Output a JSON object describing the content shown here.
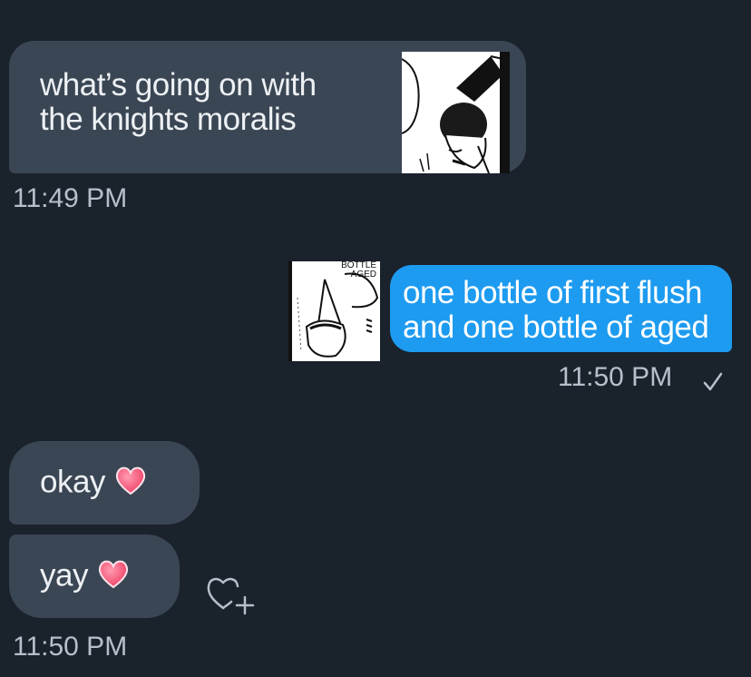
{
  "messages": [
    {
      "id": "m1",
      "direction": "incoming",
      "lines": [
        "what’s going on with",
        "the knights moralis"
      ],
      "has_sticker": true
    },
    {
      "id": "t1",
      "timestamp": "11:49 PM"
    },
    {
      "id": "m2",
      "direction": "outgoing",
      "lines": [
        "one bottle of first flush",
        "and one bottle of aged"
      ],
      "has_sticker": true,
      "sticker_text": [
        "BOTTLE",
        "AGED"
      ]
    },
    {
      "id": "t2",
      "timestamp": "11:50 PM",
      "status": "sent-check-icon"
    },
    {
      "id": "m3",
      "direction": "incoming",
      "text": "okay",
      "emoji": "heart-icon"
    },
    {
      "id": "m4",
      "direction": "incoming",
      "text": "yay",
      "emoji": "heart-icon"
    },
    {
      "id": "t3",
      "timestamp": "11:50 PM"
    }
  ],
  "icons": {
    "reaction": "add-reaction-icon",
    "sent": "check-icon",
    "emoji": "heart-icon"
  },
  "colors": {
    "background": "#1a222c",
    "incoming_bubble": "#3a4654",
    "outgoing_bubble": "#1d9bf0",
    "timestamp": "#b7c0ca",
    "heart": "#f0506e"
  }
}
